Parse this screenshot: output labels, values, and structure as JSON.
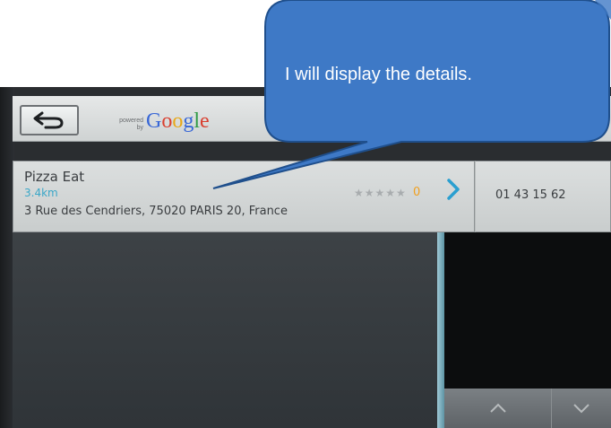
{
  "app": {
    "back_icon": "back-arrow-icon",
    "powered_by_label": "powered by",
    "google_logo": "Google"
  },
  "result": {
    "name": "Pizza Eat",
    "distance": "3.4km",
    "address": "3 Rue des Cendriers, 75020 PARIS 20, France",
    "rating_stars": "★★★★★",
    "rating_count": "0",
    "details_icon": "chevron-right-icon",
    "phone": "01 43 15 62"
  },
  "scroll": {
    "up_icon": "chevron-up-icon",
    "down_icon": "chevron-down-icon"
  },
  "callout": {
    "text": "I will display the details."
  },
  "colors": {
    "accent": "#2a9fd0",
    "distance": "#3aa7c8",
    "rating": "#f0a020",
    "callout_fill": "#3e79c6",
    "callout_stroke": "#1f4f8c"
  }
}
